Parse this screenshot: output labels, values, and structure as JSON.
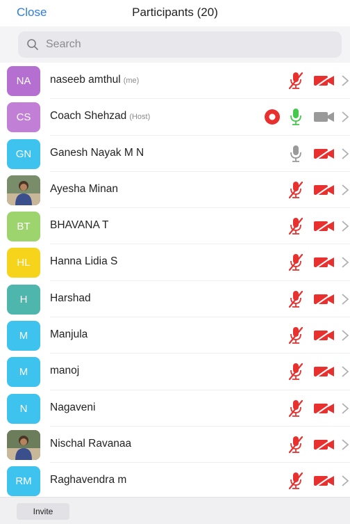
{
  "header": {
    "close_label": "Close",
    "title": "Participants (20)"
  },
  "search": {
    "placeholder": "Search",
    "value": ""
  },
  "colors": {
    "accent": "#2d7be6",
    "muted_red": "#e8312f",
    "unmuted_green": "#45c94c",
    "gray_icon": "#9a9a9a"
  },
  "participants": [
    {
      "initials": "NA",
      "name": "naseeb amthul",
      "tag": "(me)",
      "avatar_color": "#b56fd1",
      "avatar_type": "initials",
      "recording": false,
      "mic": "muted",
      "video": "off"
    },
    {
      "initials": "CS",
      "name": "Coach Shehzad",
      "tag": "(Host)",
      "avatar_color": "#c17fd6",
      "avatar_type": "initials",
      "recording": true,
      "mic": "on",
      "video": "on"
    },
    {
      "initials": "GN",
      "name": "Ganesh Nayak M N",
      "tag": "",
      "avatar_color": "#3ec3ef",
      "avatar_type": "initials",
      "recording": false,
      "mic": "gray",
      "video": "off"
    },
    {
      "initials": "",
      "name": "Ayesha Minan",
      "tag": "",
      "avatar_color": "#7a8d6a",
      "avatar_type": "photo",
      "recording": false,
      "mic": "muted",
      "video": "off"
    },
    {
      "initials": "BT",
      "name": "BHAVANA T",
      "tag": "",
      "avatar_color": "#9ed46e",
      "avatar_type": "initials",
      "recording": false,
      "mic": "muted",
      "video": "off"
    },
    {
      "initials": "HL",
      "name": "Hanna Lidia S",
      "tag": "",
      "avatar_color": "#f7d41c",
      "avatar_type": "initials",
      "recording": false,
      "mic": "muted",
      "video": "off"
    },
    {
      "initials": "H",
      "name": "Harshad",
      "tag": "",
      "avatar_color": "#4fb6ad",
      "avatar_type": "initials",
      "recording": false,
      "mic": "muted",
      "video": "off"
    },
    {
      "initials": "M",
      "name": "Manjula",
      "tag": "",
      "avatar_color": "#3ec3ef",
      "avatar_type": "initials",
      "recording": false,
      "mic": "muted",
      "video": "off"
    },
    {
      "initials": "M",
      "name": "manoj",
      "tag": "",
      "avatar_color": "#3ec3ef",
      "avatar_type": "initials",
      "recording": false,
      "mic": "muted",
      "video": "off"
    },
    {
      "initials": "N",
      "name": "Nagaveni",
      "tag": "",
      "avatar_color": "#3ec3ef",
      "avatar_type": "initials",
      "recording": false,
      "mic": "muted",
      "video": "off"
    },
    {
      "initials": "",
      "name": "Nischal Ravanaa",
      "tag": "",
      "avatar_color": "#6b7d5a",
      "avatar_type": "photo",
      "recording": false,
      "mic": "muted",
      "video": "off"
    },
    {
      "initials": "RM",
      "name": "Raghavendra m",
      "tag": "",
      "avatar_color": "#3ec3ef",
      "avatar_type": "initials",
      "recording": false,
      "mic": "muted",
      "video": "off"
    }
  ],
  "footer": {
    "invite_label": "Invite"
  }
}
